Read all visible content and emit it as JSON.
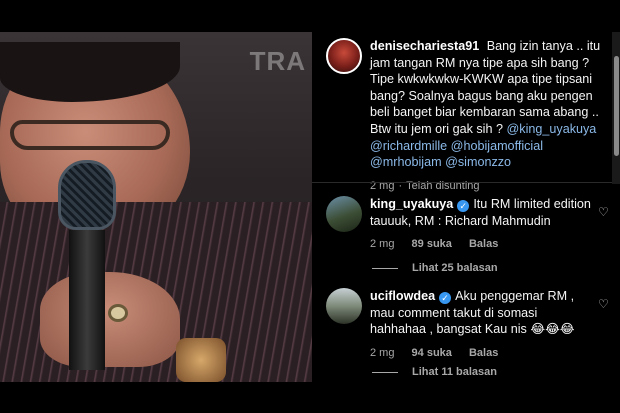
{
  "video": {
    "overlay_text": "TRA"
  },
  "post": {
    "username": "denisechariesta91",
    "caption": "Bang izin tanya .. itu jam tangan RM nya tipe apa sih bang ? Tipe kwkwkwkw-KWKW apa tipe tipsani bang? Soalnya bagus bang aku pengen beli banget biar kembaran sama abang .. Btw itu jem ori gak sih ?",
    "mentions": [
      "@king_uyakuya",
      "@richardmille",
      "@hobijamofficial",
      "@mrhobijam",
      "@simonzzo"
    ],
    "time": "2 mg",
    "status": "Telah disunting"
  },
  "comments": [
    {
      "username": "king_uyakuya",
      "verified": true,
      "text": "Itu RM limited edition tauuuk, RM : Richard Mahmudin",
      "time": "2 mg",
      "likes": "89 suka",
      "reply_label": "Balas",
      "view_replies": "Lihat 25 balasan"
    },
    {
      "username": "uciflowdea",
      "verified": true,
      "text": "Aku penggemar RM , mau comment takut di somasi hahhahaa , bangsat Kau nis 😂😂😂",
      "time": "2 mg",
      "likes": "94 suka",
      "reply_label": "Balas",
      "view_replies": "Lihat 11 balasan"
    }
  ],
  "colors": {
    "mention": "#8bb9e8",
    "verified": "#3897f0",
    "muted": "#a8a8a8"
  },
  "icons": {
    "like": "heart-icon",
    "verified": "verified-badge-icon"
  }
}
